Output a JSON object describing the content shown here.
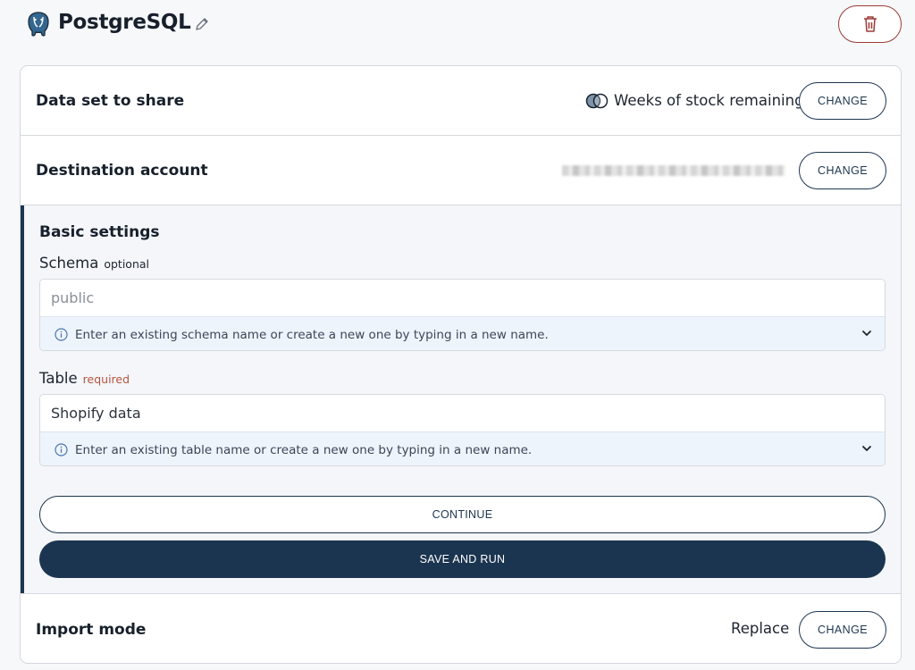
{
  "header": {
    "title": "PostgreSQL",
    "logo_icon": "postgresql-elephant-icon",
    "edit_icon": "pencil-icon",
    "delete_icon": "trash-icon"
  },
  "dataset": {
    "title": "Data set to share",
    "value": "Weeks of stock remaining",
    "change_label": "CHANGE"
  },
  "destination": {
    "title": "Destination account",
    "change_label": "CHANGE"
  },
  "basic_settings": {
    "title": "Basic settings",
    "schema": {
      "label": "Schema",
      "tag": "optional",
      "placeholder": "public",
      "value": "",
      "hint": "Enter an existing schema name or create a new one by typing in a new name."
    },
    "table": {
      "label": "Table",
      "tag": "required",
      "value": "Shopify data",
      "hint": "Enter an existing table name or create a new one by typing in a new name."
    },
    "continue_label": "CONTINUE",
    "save_label": "SAVE AND RUN"
  },
  "import_mode": {
    "title": "Import mode",
    "value": "Replace",
    "change_label": "CHANGE"
  },
  "colors": {
    "primary": "#1b3550",
    "delete_border": "#9c3b36",
    "required": "#b5553f",
    "hint_bg": "#eef4fc"
  }
}
